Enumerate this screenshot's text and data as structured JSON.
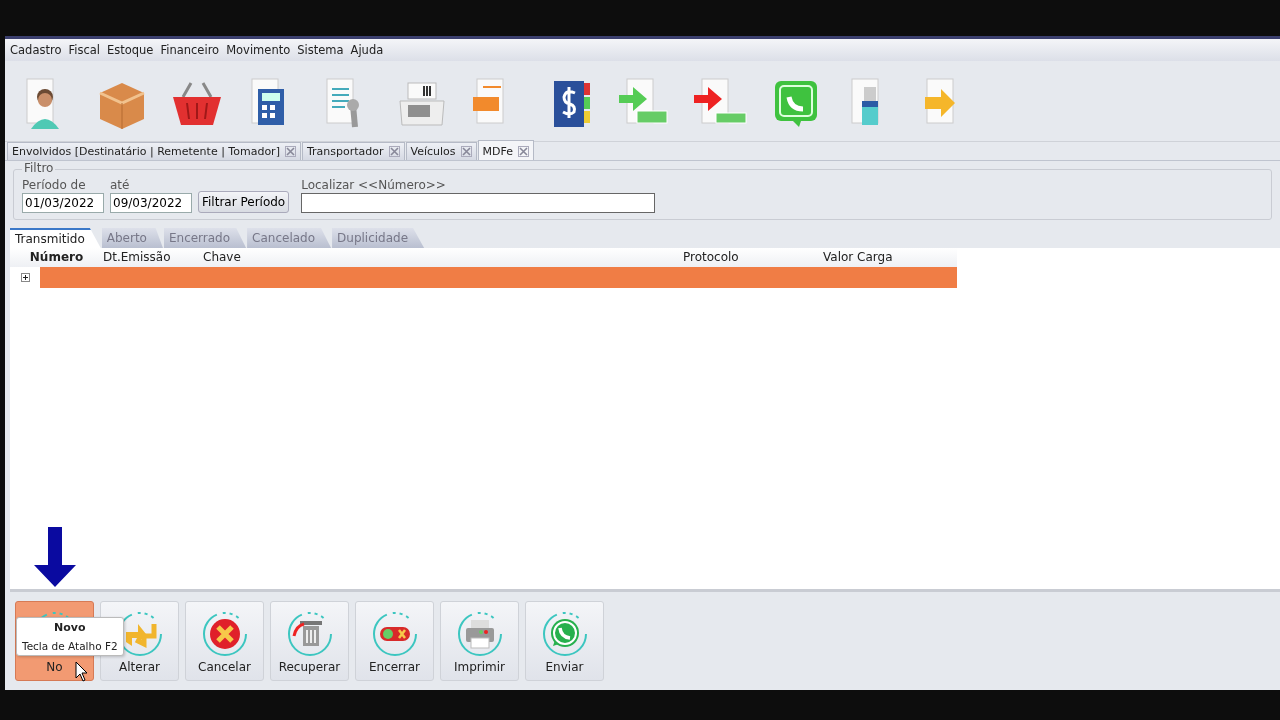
{
  "menu": [
    "Cadastro",
    "Fiscal",
    "Estoque",
    "Financeiro",
    "Movimento",
    "Sistema",
    "Ajuda"
  ],
  "tabs": [
    {
      "label": "Envolvidos [Destinatário | Remetente | Tomador]",
      "selected": false
    },
    {
      "label": "Transportador",
      "selected": false
    },
    {
      "label": "Veículos",
      "selected": false
    },
    {
      "label": "MDFe",
      "selected": true
    }
  ],
  "filter": {
    "title": "Filtro",
    "from_label": "Período de",
    "from": "01/03/2022",
    "to_label": "até",
    "to": "09/03/2022",
    "button": "Filtrar Período",
    "search_label": "Localizar <<Número>>"
  },
  "status_tabs": [
    {
      "label": "Transmitido",
      "selected": true
    },
    {
      "label": "Aberto",
      "selected": false
    },
    {
      "label": "Encerrado",
      "selected": false
    },
    {
      "label": "Cancelado",
      "selected": false
    },
    {
      "label": "Duplicidade",
      "selected": false
    }
  ],
  "table": {
    "columns": [
      "Número",
      "Dt.Emissão",
      "Chave",
      "Protocolo",
      "Valor Carga"
    ],
    "rows": [
      {
        "selected": true
      }
    ]
  },
  "buttons": [
    {
      "label": "No",
      "hover": true
    },
    {
      "label": "Alterar",
      "hover": false
    },
    {
      "label": "Cancelar",
      "hover": false
    },
    {
      "label": "Recuperar",
      "hover": false
    },
    {
      "label": "Encerrar",
      "hover": false
    },
    {
      "label": "Imprimir",
      "hover": false
    },
    {
      "label": "Enviar",
      "hover": false
    }
  ],
  "tooltip": {
    "title": "Novo",
    "text": "Tecla de Atalho F2"
  }
}
